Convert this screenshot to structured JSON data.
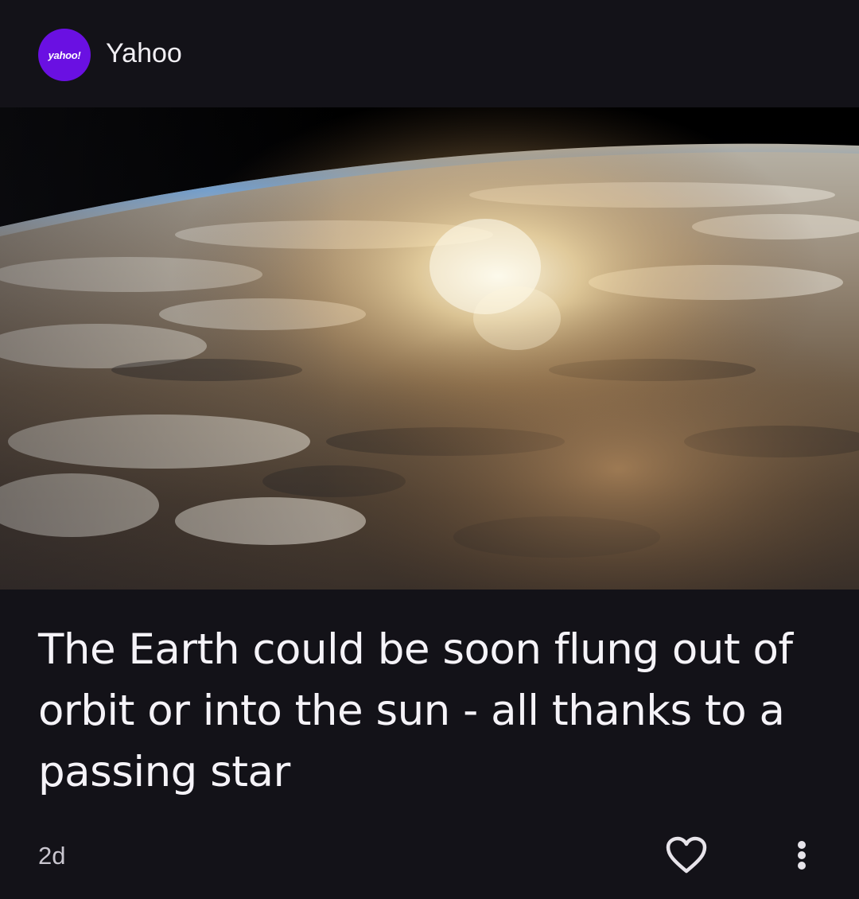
{
  "source": {
    "logo_text": "yahoo!",
    "name": "Yahoo",
    "logo_color": "#6a10e2"
  },
  "article": {
    "image_description_icon": "earth-from-space-image",
    "headline": "The Earth could be soon flung out of orbit or into the sun - all thanks to a passing star",
    "age": "2d"
  },
  "actions": {
    "like_icon": "heart-outline-icon",
    "more_icon": "more-vertical-icon"
  },
  "colors": {
    "background": "#131218",
    "text": "#f5f3f8",
    "muted_text": "#c9c6cf"
  }
}
